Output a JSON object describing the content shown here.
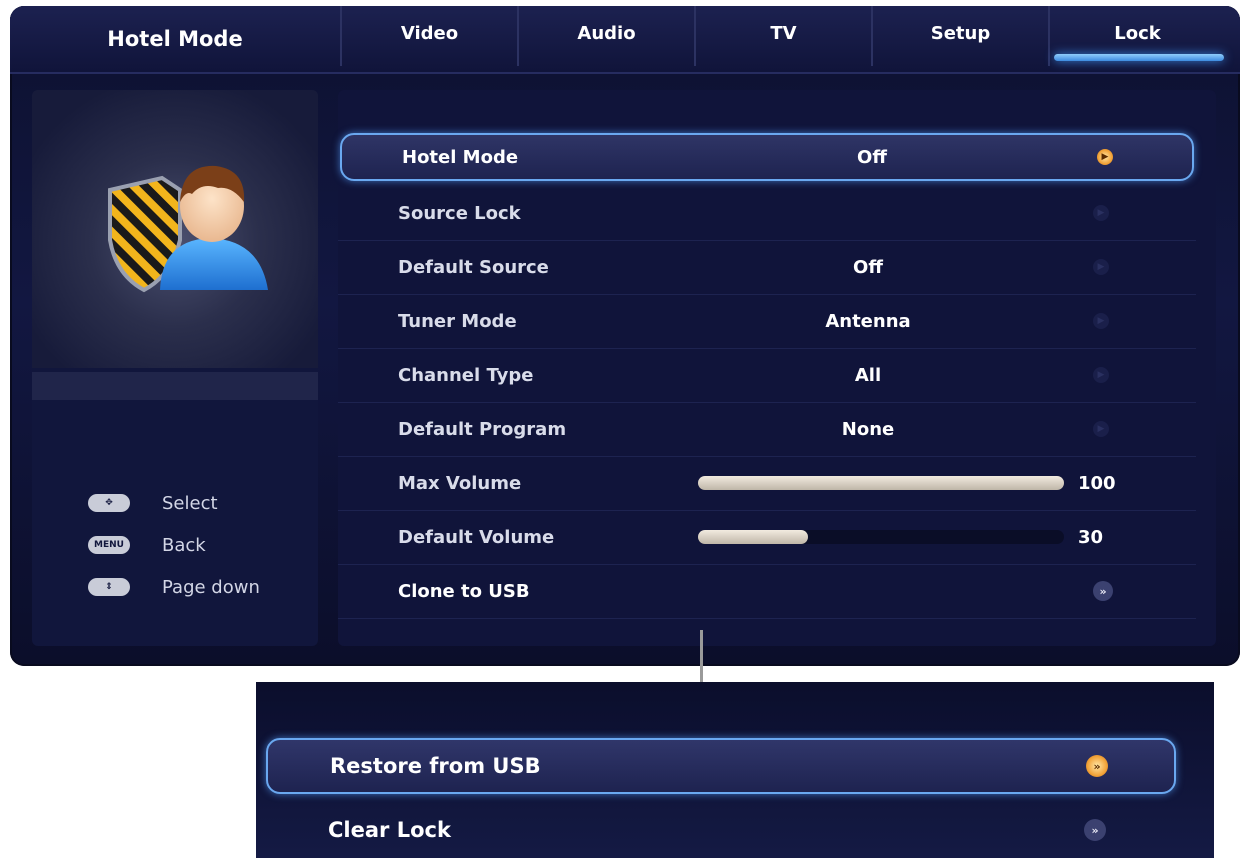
{
  "header": {
    "title": "Hotel Mode",
    "tabs": [
      "Video",
      "Audio",
      "TV",
      "Setup",
      "Lock"
    ],
    "active_tab": "Lock"
  },
  "help": {
    "items": [
      {
        "key": "✥",
        "label": "Select"
      },
      {
        "key": "MENU",
        "label": "Back"
      },
      {
        "key": "⇕",
        "label": "Page down"
      }
    ]
  },
  "menu": {
    "rows": [
      {
        "label": "Hotel Mode",
        "value": "Off"
      },
      {
        "label": "Source Lock",
        "value": ""
      },
      {
        "label": "Default Source",
        "value": "Off"
      },
      {
        "label": "Tuner Mode",
        "value": "Antenna"
      },
      {
        "label": "Channel Type",
        "value": "All"
      },
      {
        "label": "Default Program",
        "value": "None"
      },
      {
        "label": "Max Volume",
        "value": "100",
        "level": 100
      },
      {
        "label": "Default Volume",
        "value": "30",
        "level": 30
      },
      {
        "label": "Clone to USB",
        "value": ""
      }
    ]
  },
  "submenu": {
    "rows": [
      {
        "label": "Restore from USB"
      },
      {
        "label": "Clear Lock"
      }
    ]
  },
  "icons": {
    "arrow_active": "arrow-right-active-icon",
    "arrow_inactive": "arrow-right-dim-icon",
    "enter": "double-chevron-icon"
  },
  "colors": {
    "accent": "#6aa8f0",
    "active_arrow": "#f2a43a"
  }
}
